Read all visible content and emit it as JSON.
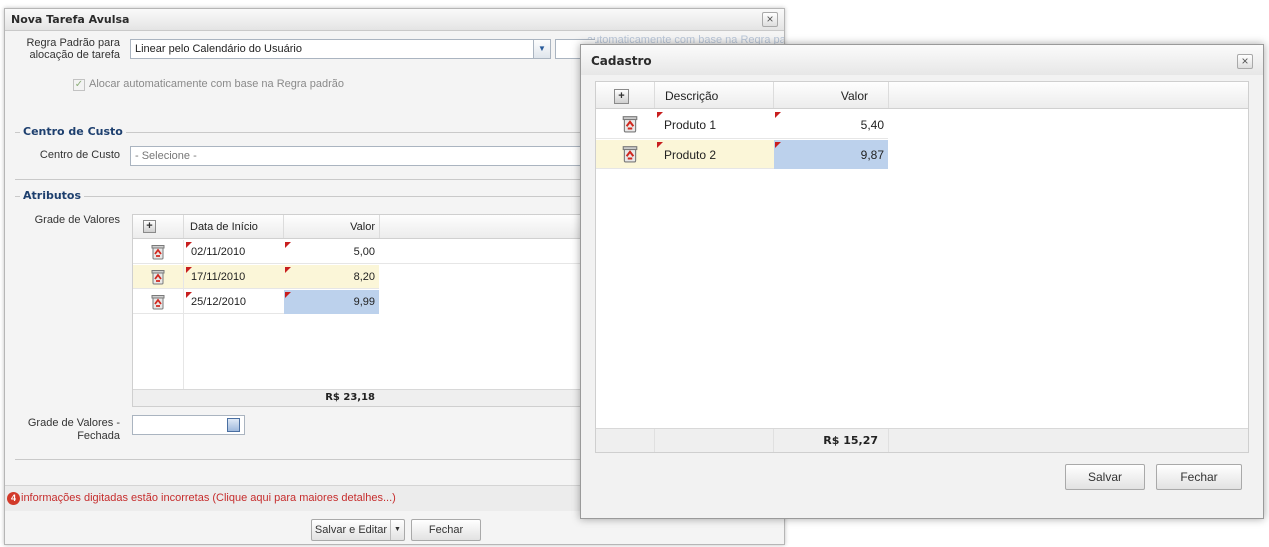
{
  "main_window": {
    "title": "Nova Tarefa Avulsa",
    "close_glyph": "×",
    "rule_label_line1": "Regra Padrão para",
    "rule_label_line2": "alocação de tarefa",
    "rule_value": "Linear pelo Calendário do Usuário",
    "auto_alloc_label": "Alocar automaticamente com base na Regra padrão",
    "auto_alloc_checked": true,
    "cost_center_section": "Centro de Custo",
    "cost_center_label": "Centro de Custo",
    "cost_center_value": "- Selecione -",
    "attributes_section": "Atributos",
    "grid_label": "Grade de Valores",
    "grid": {
      "columns": [
        "Data de Início",
        "Valor"
      ],
      "rows": [
        {
          "date": "02/11/2010",
          "value": "5,00"
        },
        {
          "date": "17/11/2010",
          "value": "8,20"
        },
        {
          "date": "25/12/2010",
          "value": "9,99"
        }
      ],
      "total": "R$ 23,18"
    },
    "closed_grid_label_line1": "Grade de Valores -",
    "closed_grid_label_line2": "Fechada",
    "closed_grid_value": "",
    "error_count": "4",
    "error_text": "informações digitadas estão incorretas (Clique aqui para maiores detalhes...)",
    "save_edit_button": "Salvar e Editar",
    "close_button": "Fechar",
    "background_text_1": "automaticamente com base na Regra padrão"
  },
  "dialog": {
    "title": "Cadastro",
    "close_glyph": "×",
    "columns": [
      "Descrição",
      "Valor"
    ],
    "rows": [
      {
        "description": "Produto 1",
        "value": "5,40"
      },
      {
        "description": "Produto 2",
        "value": "9,87"
      }
    ],
    "total": "R$ 15,27",
    "save_button": "Salvar",
    "close_button": "Fechar"
  },
  "colors": {
    "section_title": "#1d3f6e",
    "error_text": "#c62d2d",
    "selected_row": "#fbf6d8",
    "editing_cell": "#bcd1ec"
  },
  "icons": {
    "add": "plus-icon",
    "delete": "trash-icon",
    "calendar": "calendar-icon",
    "error": "error-icon"
  }
}
